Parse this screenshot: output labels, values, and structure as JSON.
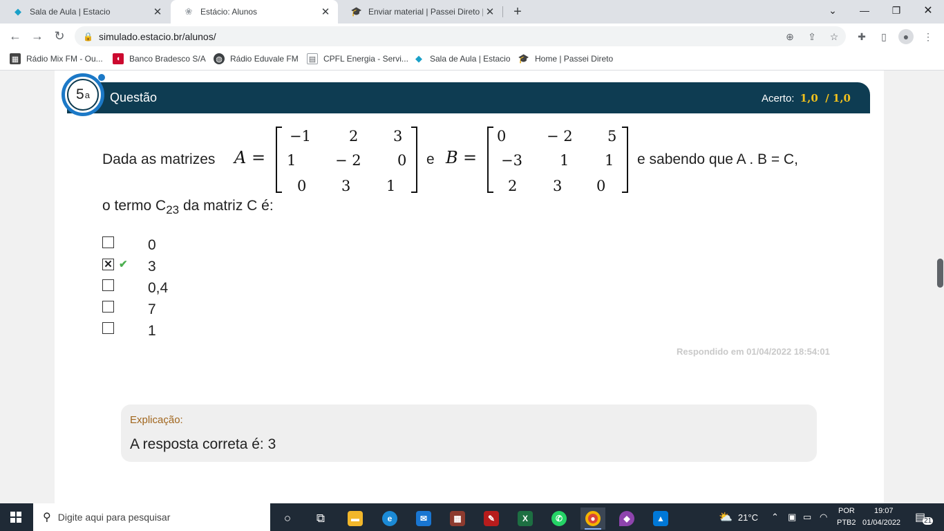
{
  "browser": {
    "tabs": [
      {
        "title": "Sala de Aula | Estacio",
        "icon": "estacio-diamond-icon"
      },
      {
        "title": "Estácio: Alunos",
        "icon": "brain-icon",
        "active": true
      },
      {
        "title": "Enviar material | Passei Direto | Pa",
        "icon": "passei-direto-icon"
      }
    ],
    "url": "simulado.estacio.br/alunos/",
    "bookmarks": [
      {
        "label": "Rádio Mix FM - Ou...",
        "icon": "radio-mix-icon"
      },
      {
        "label": "Banco Bradesco S/A",
        "icon": "bradesco-icon"
      },
      {
        "label": "Rádio Eduvale FM",
        "icon": "globe-icon"
      },
      {
        "label": "CPFL Energia - Servi...",
        "icon": "page-icon"
      },
      {
        "label": "Sala de Aula | Estacio",
        "icon": "estacio-diamond-icon"
      },
      {
        "label": "Home | Passei Direto",
        "icon": "passei-direto-icon"
      }
    ]
  },
  "question": {
    "number": "5",
    "ordinal": "a",
    "label": "Questão",
    "score_label": "Acerto:",
    "score_value": "1,0  / 1,0",
    "stmt_prefix": "Dada as matrizes",
    "var_a": "A",
    "equals": "=",
    "matrix_a": [
      [
        "−1",
        "2",
        "3"
      ],
      [
        "1",
        "− 2",
        "0"
      ],
      [
        "0",
        "3",
        "1"
      ]
    ],
    "conj": "e",
    "var_b": "B",
    "matrix_b": [
      [
        "0",
        "− 2",
        "5"
      ],
      [
        "−3",
        "1",
        "1"
      ],
      [
        "2",
        "3",
        "0"
      ]
    ],
    "stmt_suffix": "e sabendo que A . B = C,",
    "line2_start": "o termo C",
    "line2_sub": "23",
    "line2_end": " da matriz C é:",
    "options": [
      {
        "label": "0",
        "checked": false
      },
      {
        "label": "3",
        "checked": true,
        "correct": true
      },
      {
        "label": "0,4",
        "checked": false
      },
      {
        "label": "7",
        "checked": false
      },
      {
        "label": "1",
        "checked": false
      }
    ],
    "answered_at": "Respondido em 01/04/2022 18:54:01",
    "explanation_title": "Explicação:",
    "explanation_text": "A resposta correta é: 3"
  },
  "taskbar": {
    "search_placeholder": "Digite aqui para pesquisar",
    "weather": "21°C",
    "lang_top": "POR",
    "lang_bottom": "PTB2",
    "time": "19:07",
    "date": "01/04/2022",
    "notifications": "21"
  },
  "colors": {
    "header_bg": "#0e3c52",
    "badge_ring": "#1c79c7",
    "score": "#f2c11d",
    "correct_tick": "#4caf50",
    "explanation_title": "#a0651c"
  }
}
